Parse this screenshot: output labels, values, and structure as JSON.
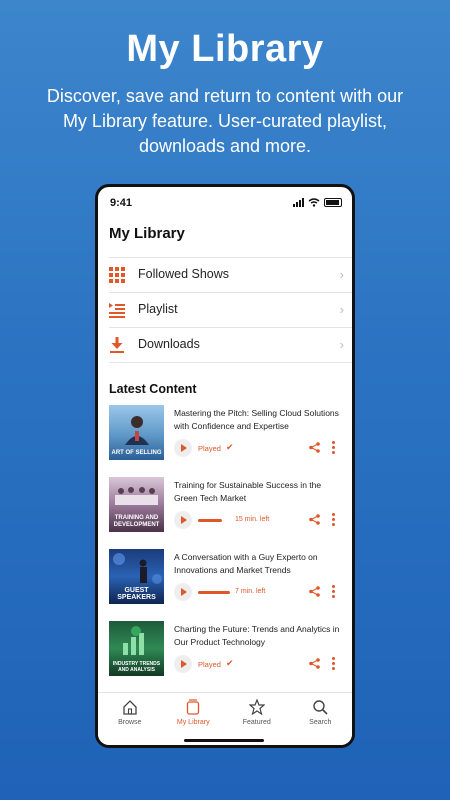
{
  "hero": {
    "title": "My Library",
    "subtitle": "Discover, save and return to content with our My Library feature. User-curated playlist, downloads and more."
  },
  "status": {
    "time": "9:41"
  },
  "app": {
    "title": "My Library"
  },
  "menu": [
    {
      "label": "Followed Shows",
      "icon": "grid-icon"
    },
    {
      "label": "Playlist",
      "icon": "playlist-icon"
    },
    {
      "label": "Downloads",
      "icon": "download-icon"
    }
  ],
  "latest": {
    "title": "Latest Content",
    "items": [
      {
        "title": "Mastering the Pitch: Selling Cloud Solutions with Confidence and Expertise",
        "thumb_caption": "ART OF SELLING",
        "status": "Played",
        "progress": null,
        "time_left": ""
      },
      {
        "title": "Training for Sustainable Success in the Green Tech Market",
        "thumb_caption": "TRAINING AND DEVELOPMENT",
        "status": "",
        "progress": 0.6,
        "time_left": "15 min. left"
      },
      {
        "title": "A Conversation with a Guy Experto on Innovations and Market Trends",
        "thumb_caption": "GUEST SPEAKERS",
        "status": "",
        "progress": 0.8,
        "time_left": "7 min. left"
      },
      {
        "title": "Charting the Future: Trends and Analytics in Our Product Technology",
        "thumb_caption": "INDUSTRY TRENDS AND ANALYSIS",
        "status": "Played",
        "progress": null,
        "time_left": ""
      }
    ]
  },
  "tabs": [
    {
      "label": "Browse",
      "icon": "home-icon"
    },
    {
      "label": "My Library",
      "icon": "library-icon",
      "active": true
    },
    {
      "label": "Featured",
      "icon": "star-icon"
    },
    {
      "label": "Search",
      "icon": "search-icon"
    }
  ],
  "colors": {
    "accent": "#e0572a",
    "background": "#2b73c2"
  }
}
